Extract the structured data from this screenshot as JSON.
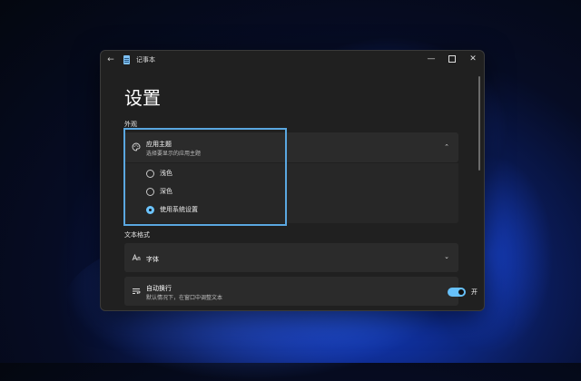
{
  "window": {
    "title": "记事本",
    "back_glyph": "←",
    "minimize_glyph": "—",
    "close_glyph": "✕"
  },
  "page": {
    "title": "设置"
  },
  "sections": {
    "appearance": "外观",
    "text_format": "文本格式"
  },
  "theme": {
    "title": "应用主题",
    "subtitle": "选择要显示的应用主题",
    "chevron": "⌃",
    "options": [
      {
        "label": "浅色",
        "selected": false
      },
      {
        "label": "深色",
        "selected": false
      },
      {
        "label": "使用系统设置",
        "selected": true
      }
    ]
  },
  "font": {
    "title": "字体",
    "chevron": "⌄"
  },
  "wrap": {
    "title": "自动换行",
    "subtitle": "默认情况下，在窗口中调整文本",
    "toggle_state": "开",
    "toggle_on": true
  },
  "colors": {
    "accent": "#67c1fb",
    "window_bg": "#202020",
    "card_bg": "#2b2b2b",
    "highlight": "#5aa7e0"
  }
}
